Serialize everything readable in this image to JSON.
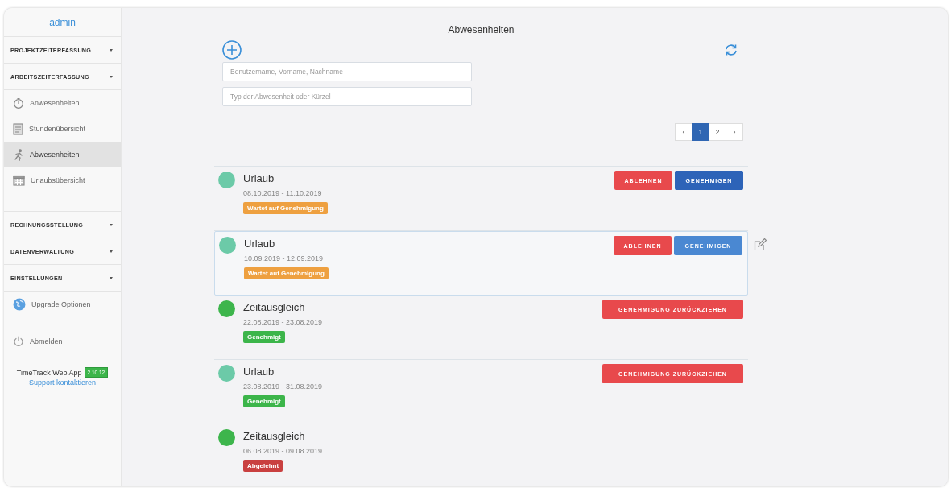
{
  "sidebar": {
    "user": "admin",
    "items": [
      {
        "kind": "section",
        "label": "PROJEKTZEITERFASSUNG"
      },
      {
        "kind": "section",
        "label": "ARBEITSZEITERFASSUNG"
      },
      {
        "kind": "link",
        "label": "Anwesenheiten",
        "selected": false
      },
      {
        "kind": "link",
        "label": "Stundenübersicht",
        "selected": false
      },
      {
        "kind": "link",
        "label": "Abwesenheiten",
        "selected": true
      },
      {
        "kind": "link",
        "label": "Urlaubsübersicht",
        "selected": false
      },
      {
        "kind": "spacer"
      },
      {
        "kind": "section",
        "label": "RECHNUNGSSTELLUNG"
      },
      {
        "kind": "section",
        "label": "DATENVERWALTUNG"
      },
      {
        "kind": "section",
        "label": "EINSTELLUNGEN"
      },
      {
        "kind": "link",
        "label": "Upgrade Optionen",
        "selected": false
      },
      {
        "kind": "spacer"
      },
      {
        "kind": "link",
        "label": "Abmelden",
        "selected": false
      }
    ],
    "app_name": "TimeTrack Web App",
    "version": "2.10.12",
    "support_link": "Support kontaktieren"
  },
  "main": {
    "title": "Abwesenheiten",
    "search_fields": [
      {
        "placeholder": "Benutzername, Vorname, Nachname"
      },
      {
        "placeholder": "Typ der Abwesenheit oder Kürzel"
      }
    ],
    "pagination": {
      "prev": "‹",
      "pages": [
        {
          "label": "1",
          "selected": true
        },
        {
          "label": "2",
          "selected": false
        }
      ],
      "next": "›"
    },
    "absences": [
      {
        "type": "Urlaub",
        "color": "#6ccaa8",
        "dates": "08.10.2019 - 11.10.2019",
        "status": {
          "kind": "pending",
          "label": "Wartet auf Genehmigung"
        },
        "hovered": false,
        "actions": [
          {
            "kind": "reject",
            "label": "ABLEHNEN"
          },
          {
            "kind": "approve",
            "label": "GENEHMIGEN"
          }
        ]
      },
      {
        "type": "Urlaub",
        "color": "#6ccaa8",
        "dates": "10.09.2019 - 12.09.2019",
        "status": {
          "kind": "pending",
          "label": "Wartet auf Genehmigung"
        },
        "hovered": true,
        "actions": [
          {
            "kind": "reject",
            "label": "ABLEHNEN"
          },
          {
            "kind": "approve",
            "label": "GENEHMIGEN"
          }
        ]
      },
      {
        "type": "Zeitausgleich",
        "color": "#3db54c",
        "dates": "22.08.2019 - 23.08.2019",
        "status": {
          "kind": "approved",
          "label": "Genehmigt"
        },
        "hovered": false,
        "actions": [
          {
            "kind": "withdraw",
            "label": "GENEHMIGUNG ZURÜCKZIEHEN"
          }
        ]
      },
      {
        "type": "Urlaub",
        "color": "#6ccaa8",
        "dates": "23.08.2019 - 31.08.2019",
        "status": {
          "kind": "approved",
          "label": "Genehmigt"
        },
        "hovered": false,
        "actions": [
          {
            "kind": "withdraw",
            "label": "GENEHMIGUNG ZURÜCKZIEHEN"
          }
        ]
      },
      {
        "type": "Zeitausgleich",
        "color": "#3db54c",
        "dates": "06.08.2019 - 09.08.2019",
        "status": {
          "kind": "rejected",
          "label": "Abgelehnt"
        },
        "hovered": false
      }
    ]
  }
}
